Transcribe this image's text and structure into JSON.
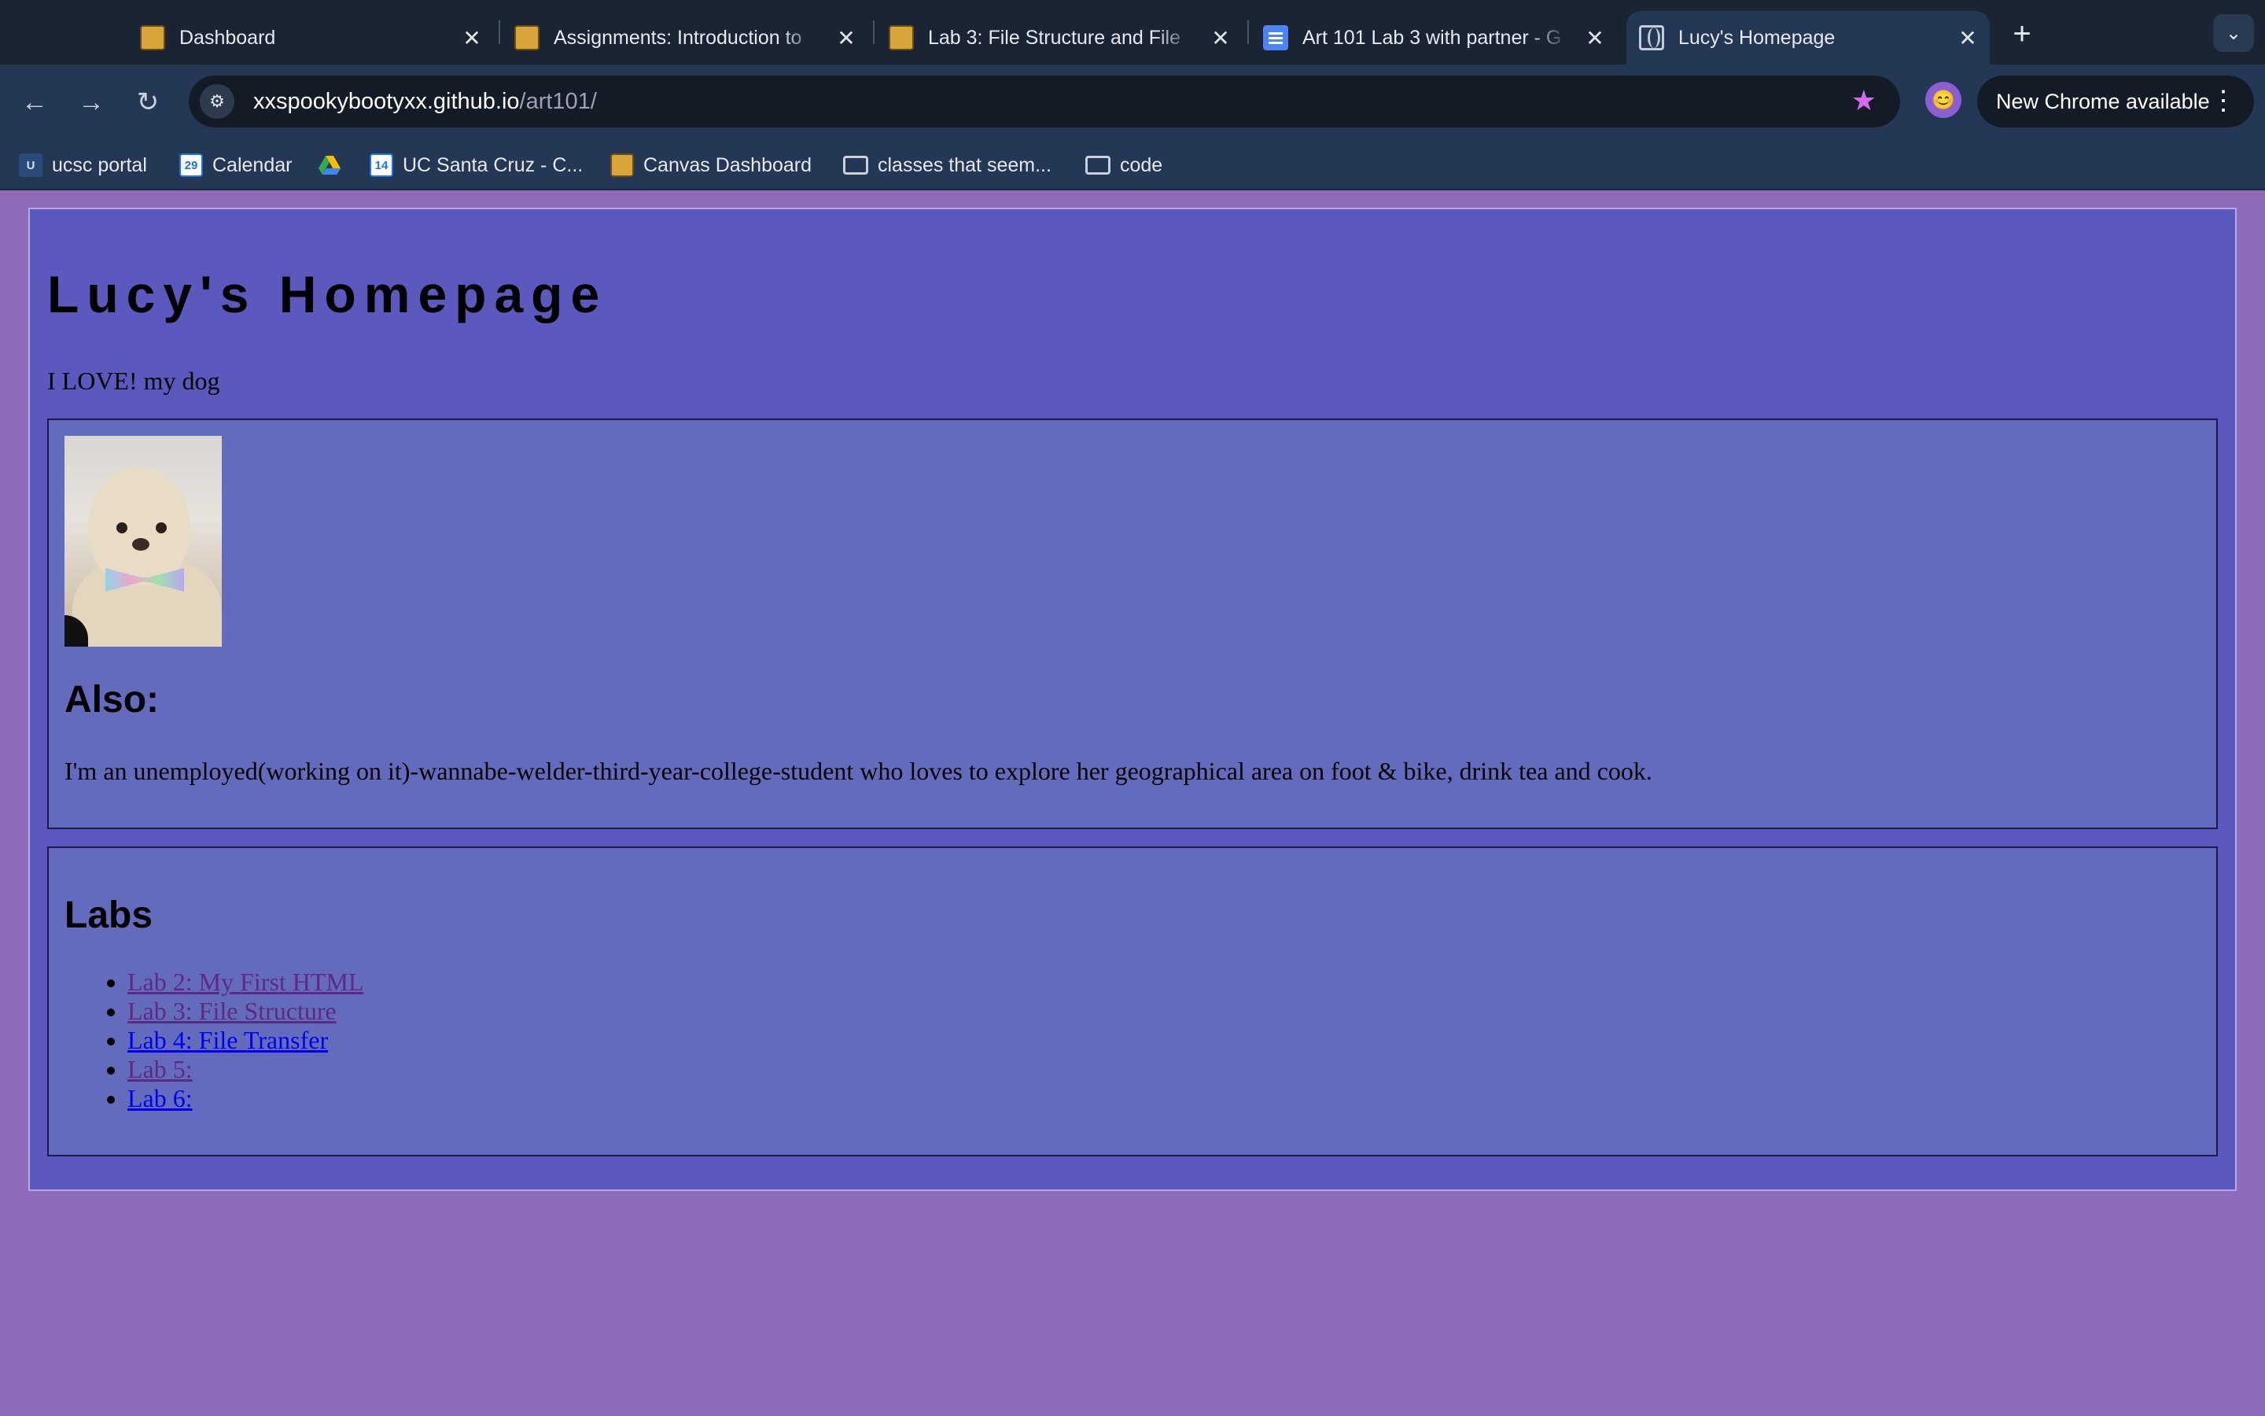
{
  "browser": {
    "tabs": [
      {
        "title": "Dashboard",
        "icon": "ucsc-favicon-icon",
        "active": false
      },
      {
        "title": "Assignments: Introduction to",
        "icon": "ucsc-favicon-icon",
        "active": false
      },
      {
        "title": "Lab 3: File Structure and File",
        "icon": "ucsc-favicon-icon",
        "active": false
      },
      {
        "title": "Art 101 Lab 3 with partner - G",
        "icon": "docs-icon",
        "active": false
      },
      {
        "title": "Lucy's Homepage",
        "icon": "globe-icon",
        "active": true
      }
    ],
    "address": {
      "domain": "xxspookybootyxx.github.io",
      "path": "/art101/"
    },
    "update_label": "New Chrome available",
    "bookmarks": [
      {
        "label": "ucsc portal",
        "icon": "ucsc-icon"
      },
      {
        "label": "Calendar",
        "icon": "calendar-icon",
        "icon_text": "29"
      },
      {
        "label": "",
        "icon": "google-drive-icon"
      },
      {
        "label": "UC Santa Cruz - C...",
        "icon": "calendar-icon",
        "icon_text": "14"
      },
      {
        "label": "Canvas Dashboard",
        "icon": "ucsc-icon"
      },
      {
        "label": "classes that seem...",
        "icon": "folder-icon"
      },
      {
        "label": "code",
        "icon": "folder-icon"
      }
    ]
  },
  "page": {
    "title": "Lucy's Homepage",
    "tagline": "I LOVE! my dog",
    "about": {
      "heading": "Also:",
      "text": "I'm an unemployed(working on it)-wannabe-welder-third-year-college-student who loves to explore her geographical area on foot & bike, drink tea and cook."
    },
    "labs": {
      "heading": "Labs",
      "items": [
        {
          "label": "Lab 2: My First HTML",
          "visited": true
        },
        {
          "label": "Lab 3: File Structure",
          "visited": true
        },
        {
          "label": "Lab 4: File Transfer",
          "visited": false
        },
        {
          "label": "Lab 5:",
          "visited": true
        },
        {
          "label": "Lab 6:",
          "visited": false
        }
      ]
    }
  },
  "colors": {
    "page_bg": "#8d6bb8",
    "container_bg": "#5b58be",
    "card_bg": "#656bbc",
    "visited_link": "#5b2a86",
    "link": "#0000ee",
    "bookmark_star": "#d667f0"
  }
}
